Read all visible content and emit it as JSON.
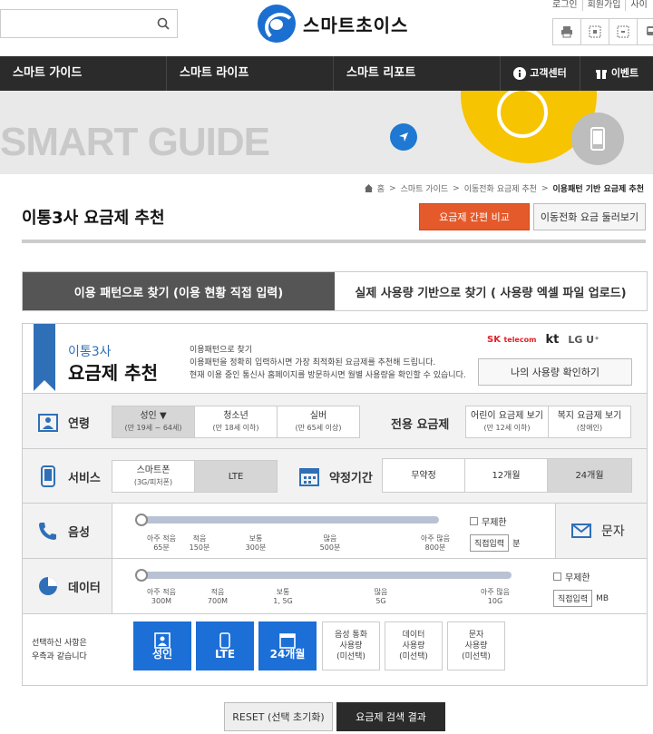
{
  "header": {
    "search_placeholder": "",
    "logo_text": "스마트초이스",
    "top_links": [
      "로그인",
      "회원가입",
      "사이"
    ]
  },
  "nav": {
    "items": [
      "스마트 가이드",
      "스마트 라이프",
      "스마트 리포트"
    ],
    "customer_center": "고객센터",
    "event": "이벤트"
  },
  "banner": {
    "text": "SMART GUIDE"
  },
  "breadcrumb": [
    "홈",
    "스마트 가이드",
    "이동전화 요금제 추천",
    "이용패턴 기반 요금제 추천"
  ],
  "page": {
    "title": "이통3사 요금제 추천",
    "compare_button": "요금제 간편 비교",
    "browse_button": "이동전화 요금 둘러보기"
  },
  "tabs": [
    "이용 패턴으로 찾기 (이용 현황 직접 입력)",
    "실제 사용량 기반으로 찾기 ( 사용량 엑셀 파일 업로드)"
  ],
  "panel": {
    "heading_small": "이통3사",
    "heading_big": "요금제 추천",
    "description": [
      "이용패턴으로 찾기",
      "이용패턴을 정확히 입력하시면 가장 최적화된 요금제를 추천해 드립니다.",
      "현재 이용 중인 통신사 홈페이지를 방문하시면 월별 사용량을 확인할 수 있습니다."
    ],
    "carriers": {
      "skt": "SK",
      "skt_sub": "telecom",
      "kt": "kt",
      "lgu": "LG U⁺"
    },
    "my_usage_button": "나의 사용량 확인하기"
  },
  "age": {
    "label": "연령",
    "options": [
      {
        "name": "성인 ▼",
        "sub": "(만 19세 ~ 64세)"
      },
      {
        "name": "청소년",
        "sub": "(만 18세 이하)"
      },
      {
        "name": "실버",
        "sub": "(만 65세 이상)"
      }
    ],
    "dedicated_label": "전용 요금제",
    "dedicated": [
      {
        "name": "어린이 요금제 보기",
        "sub": "(만 12세 이하)"
      },
      {
        "name": "복지 요금제 보기",
        "sub": "(장애인)"
      }
    ]
  },
  "service": {
    "label": "서비스",
    "options": [
      {
        "name": "스마트폰",
        "sub": "(3G/피처폰)"
      },
      {
        "name": "LTE",
        "sub": ""
      }
    ],
    "contract_label": "약정기간",
    "contract": [
      "무약정",
      "12개월",
      "24개월"
    ]
  },
  "voice": {
    "label": "음성",
    "ticks": [
      {
        "a": "아주 적음",
        "b": "65분"
      },
      {
        "a": "적음",
        "b": "150분"
      },
      {
        "a": "보통",
        "b": "300분"
      },
      {
        "a": "많음",
        "b": "500분"
      },
      {
        "a": "아주 많음",
        "b": "800분"
      }
    ],
    "unlimited": "무제한",
    "direct": "직접입력",
    "unit": "분",
    "sms": "문자",
    "level": 0
  },
  "data": {
    "label": "데이터",
    "ticks": [
      {
        "a": "아주 적음",
        "b": "300M"
      },
      {
        "a": "적음",
        "b": "700M"
      },
      {
        "a": "보통",
        "b": "1, 5G"
      },
      {
        "a": "많음",
        "b": "5G"
      },
      {
        "a": "아주 많음",
        "b": "10G"
      }
    ],
    "unlimited": "무제한",
    "direct": "직접입력",
    "unit": "MB",
    "level": 0
  },
  "summary": {
    "text": [
      "선택하신 사항은",
      "우측과 같습니다"
    ],
    "selected": [
      "성인",
      "LTE",
      "24개월"
    ],
    "unselected": [
      [
        "음성 통화",
        "사용량",
        "(미선택)"
      ],
      [
        "데이터",
        "사용량",
        "(미선택)"
      ],
      [
        "문자",
        "사용량",
        "(미선택)"
      ]
    ]
  },
  "actions": {
    "reset": "RESET (선택 초기화)",
    "search": "요금제 검색 결과"
  },
  "colors": {
    "accent": "#e55a2b",
    "brand": "#1c6fd6",
    "nav": "#2b2b2b",
    "banner_yellow": "#f6c400"
  }
}
